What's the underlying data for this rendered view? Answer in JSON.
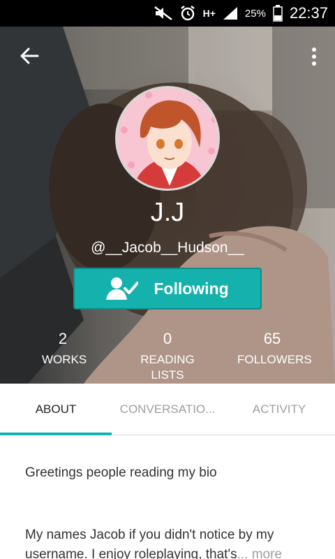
{
  "status_bar": {
    "network": "H+",
    "battery": "25%",
    "time": "22:37"
  },
  "profile": {
    "display_name": "J.J",
    "username": "@__Jacob__Hudson__",
    "follow_label": "Following"
  },
  "stats": {
    "works": {
      "value": "2",
      "label": "WORKS"
    },
    "reading_lists": {
      "value": "0",
      "label": "READING LISTS"
    },
    "followers": {
      "value": "65",
      "label": "FOLLOWERS"
    }
  },
  "tabs": [
    {
      "label": "ABOUT",
      "active": true
    },
    {
      "label": "CONVERSATIO...",
      "active": false
    },
    {
      "label": "ACTIVITY",
      "active": false
    }
  ],
  "about": {
    "greeting": "Greetings people reading my bio",
    "bio_text": "My names Jacob if you didn't notice by my username. I enjoy roleplaying, that's",
    "more_label": "... more"
  },
  "colors": {
    "accent": "#14b1ad",
    "status_bar": "#000000"
  },
  "icons": {
    "back": "arrow-left-icon",
    "more": "vertical-dots-icon",
    "following": "person-check-icon"
  }
}
